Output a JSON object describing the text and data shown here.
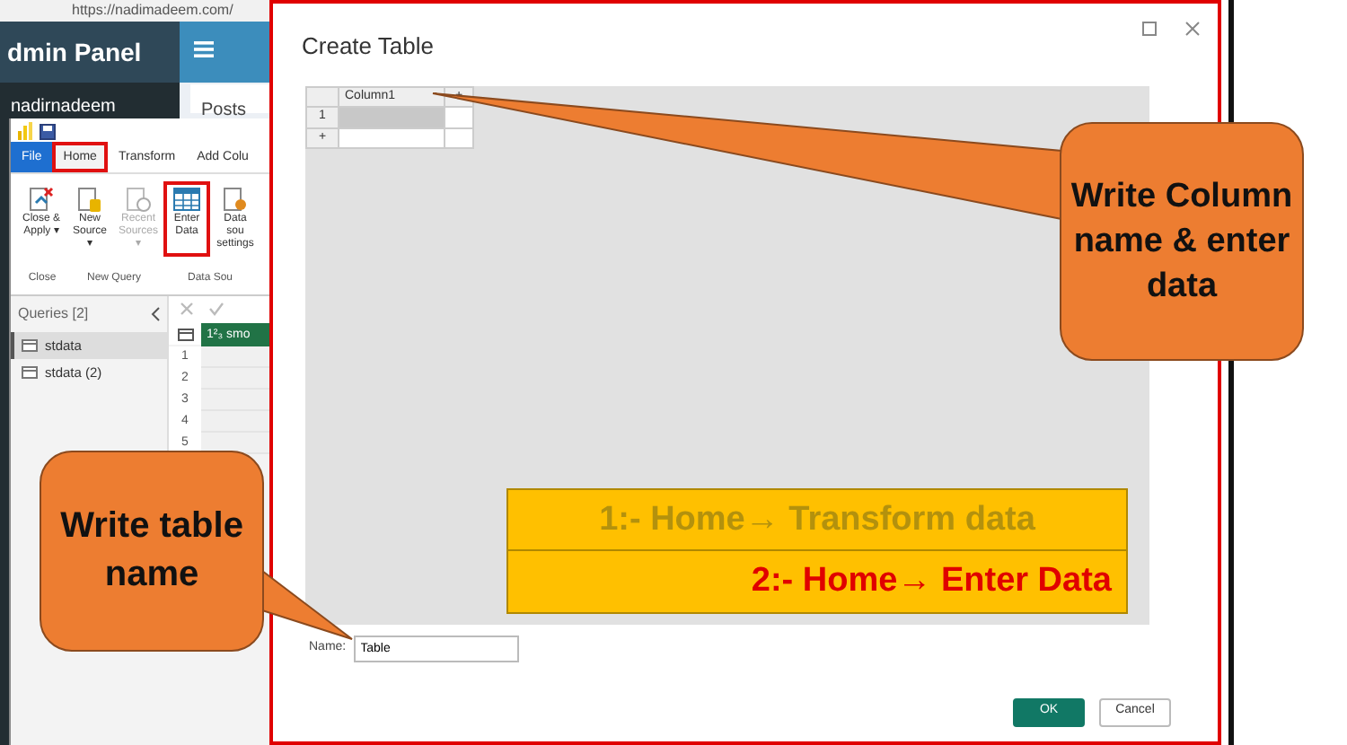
{
  "browser": {
    "url": "https://nadimadeem.com/",
    "brand": "dmin Panel",
    "user": "nadirnadeem",
    "card_title": "Posts"
  },
  "power_query": {
    "tabs": [
      {
        "label": "File",
        "selected": false,
        "highlighted": false
      },
      {
        "label": "Home",
        "selected": true,
        "highlighted": true
      },
      {
        "label": "Transform",
        "selected": false,
        "highlighted": false
      },
      {
        "label": "Add Colu",
        "selected": false,
        "highlighted": false
      }
    ],
    "ribbon_buttons": [
      {
        "kind": "close",
        "label": "Close & Apply ▾",
        "disabled": false,
        "highlighted": false
      },
      {
        "kind": "source",
        "label": "New Source ▾",
        "disabled": false,
        "highlighted": false
      },
      {
        "kind": "recent",
        "label": "Recent Sources ▾",
        "disabled": true,
        "highlighted": false
      },
      {
        "kind": "table",
        "label": "Enter Data",
        "disabled": false,
        "highlighted": true
      },
      {
        "kind": "settings",
        "label": "Data sou settings",
        "disabled": false,
        "highlighted": false
      }
    ],
    "groups": [
      "Close",
      "New Query",
      "Data Sou"
    ],
    "queries_title": "Queries [2]",
    "queries": [
      {
        "name": "stdata",
        "selected": true
      },
      {
        "name": "stdata (2)",
        "selected": false
      }
    ],
    "column_type": "1²₃",
    "column_header": "smo",
    "row_numbers": [
      "1",
      "2",
      "3",
      "4",
      "5"
    ]
  },
  "dialog": {
    "title": "Create Table",
    "columns": [
      "Column1"
    ],
    "add_column": "+",
    "rows": [
      "1"
    ],
    "add_row": "+",
    "name_label": "Name:",
    "name_value": "Table",
    "buttons": [
      {
        "kind": "primary",
        "label": "OK"
      },
      {
        "kind": "secondary",
        "label": "Cancel"
      }
    ]
  },
  "steps": [
    {
      "kind": "muted",
      "text": "1:- Home→ Transform data"
    },
    {
      "kind": "current",
      "text": "2:- Home→ Enter Data"
    }
  ],
  "callouts": [
    {
      "text": "Write Column name & enter data"
    },
    {
      "text": "Write table name"
    }
  ]
}
